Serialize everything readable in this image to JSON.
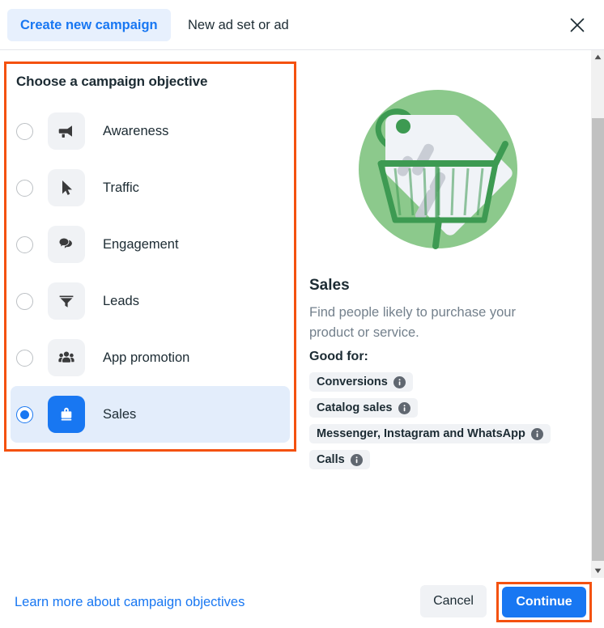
{
  "header": {
    "tab_primary": "Create new campaign",
    "tab_secondary": "New ad set or ad",
    "close_label": "Close"
  },
  "objective_panel": {
    "title": "Choose a campaign objective",
    "highlight_color": "#f4510f",
    "selected": "Sales",
    "items": [
      {
        "label": "Awareness",
        "icon": "megaphone-icon",
        "selected": false
      },
      {
        "label": "Traffic",
        "icon": "cursor-icon",
        "selected": false
      },
      {
        "label": "Engagement",
        "icon": "chat-bubbles-icon",
        "selected": false
      },
      {
        "label": "Leads",
        "icon": "funnel-icon",
        "selected": false
      },
      {
        "label": "App promotion",
        "icon": "people-group-icon",
        "selected": false
      },
      {
        "label": "Sales",
        "icon": "shopping-bag-icon",
        "selected": true
      }
    ]
  },
  "detail": {
    "illustration": "shopping-cart-price-tag-illustration",
    "title": "Sales",
    "description": "Find people likely to purchase your product or service.",
    "good_for_label": "Good for:",
    "badges": [
      {
        "label": "Conversions",
        "info": "info-icon"
      },
      {
        "label": "Catalog sales",
        "info": "info-icon"
      },
      {
        "label": "Messenger, Instagram and WhatsApp",
        "info": "info-icon"
      },
      {
        "label": "Calls",
        "info": "info-icon"
      }
    ]
  },
  "footer": {
    "learn_more": "Learn more about campaign objectives",
    "cancel": "Cancel",
    "continue": "Continue",
    "continue_highlight_color": "#f4510f"
  },
  "colors": {
    "accent_blue": "#1877f2",
    "selected_row_bg": "#e3edfb",
    "tab_bg": "#e7f0fd",
    "icon_tile_bg": "#f0f2f5",
    "highlight_orange": "#f4510f",
    "illustration_green": "#8cc98c"
  }
}
